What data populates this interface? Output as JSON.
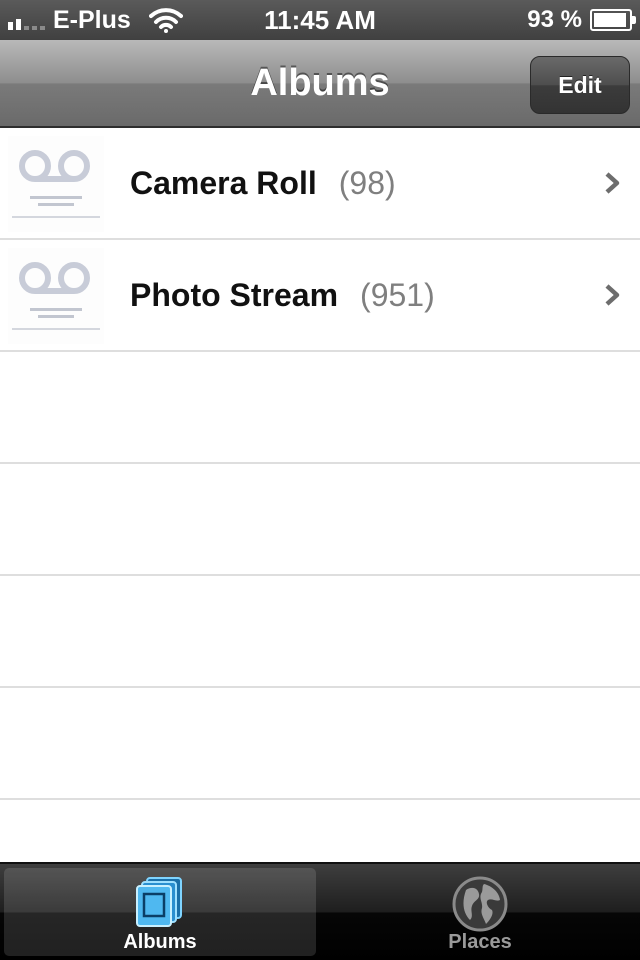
{
  "status_bar": {
    "carrier": "E-Plus",
    "time": "11:45 AM",
    "battery_percent": "93 %",
    "battery_level": 0.93,
    "signal_bars": 2
  },
  "navbar": {
    "title": "Albums",
    "edit_label": "Edit"
  },
  "albums": [
    {
      "name": "Camera Roll",
      "count": "(98)",
      "thumb_icon": "voicemail-placeholder-icon"
    },
    {
      "name": "Photo Stream",
      "count": "(951)",
      "thumb_icon": "voicemail-placeholder-icon"
    }
  ],
  "empty_rows": 5,
  "tabbar": {
    "tabs": [
      {
        "label": "Albums",
        "icon": "albums-icon",
        "selected": true
      },
      {
        "label": "Places",
        "icon": "globe-icon",
        "selected": false
      }
    ]
  },
  "colors": {
    "count_gray": "#7f7f7f",
    "accent_blue": "#4fb8f0"
  }
}
